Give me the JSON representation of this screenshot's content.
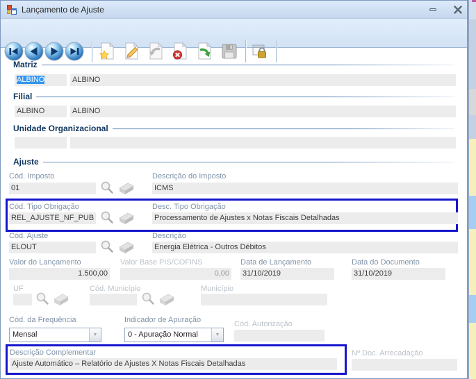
{
  "window": {
    "title": "Lançamento de Ajuste"
  },
  "toolbar": {
    "buttons": [
      "first-record",
      "previous-record",
      "next-record",
      "last-record",
      "new",
      "edit",
      "undo",
      "delete",
      "post",
      "save",
      "security-lock"
    ]
  },
  "groups": {
    "matriz": "Matriz",
    "filial": "Filial",
    "unidade": "Unidade Organizacional",
    "ajuste": "Ajuste"
  },
  "matriz": {
    "code": "ALBINO",
    "name": "ALBINO"
  },
  "filial": {
    "code": "ALBINO",
    "name": "ALBINO"
  },
  "unidade": {
    "code": "",
    "name": ""
  },
  "fields": {
    "cod_imposto": {
      "label": "Cód. Imposto",
      "value": "01"
    },
    "desc_imposto": {
      "label": "Descrição do Imposto",
      "value": "ICMS"
    },
    "cod_tipo_obrigacao": {
      "label": "Cód. Tipo Obrigação",
      "value": "REL_AJUSTE_NF_PUB"
    },
    "desc_tipo_obrigacao": {
      "label": "Desc. Tipo Obrigação",
      "value": "Processamento de Ajustes x Notas Fiscais Detalhadas"
    },
    "cod_ajuste": {
      "label": "Cód. Ajuste",
      "value": "ELOUT"
    },
    "descricao": {
      "label": "Descrição",
      "value": "Energia Elétrica - Outros Débitos"
    },
    "valor_lancamento": {
      "label": "Valor do Lançamento",
      "value": "1.500,00"
    },
    "valor_base": {
      "label": "Valor Base PIS/COFINS",
      "value": "0,00"
    },
    "data_lancamento": {
      "label": "Data de Lançamento",
      "value": "31/10/2019"
    },
    "data_documento": {
      "label": "Data do Documento",
      "value": "31/10/2019"
    },
    "uf": {
      "label": "UF",
      "value": ""
    },
    "cod_municipio": {
      "label": "Cód. Município",
      "value": ""
    },
    "municipio": {
      "label": "Município",
      "value": ""
    },
    "cod_frequencia": {
      "label": "Cód. da Frequência",
      "value": "Mensal"
    },
    "indicador_apuracao": {
      "label": "Indicador de Apuração",
      "value": "0 - Apuração Normal"
    },
    "cod_autorizacao": {
      "label": "Cód. Autorização",
      "value": ""
    },
    "descricao_complementar": {
      "label": "Descrição Complementar",
      "value": "Ajuste Automático – Relatório de Ajustes X Notas Fiscais Detalhadas"
    },
    "num_doc_arrecadacao": {
      "label": "Nº Doc. Arrecadação",
      "value": ""
    }
  },
  "icons": {
    "dropdown_arrow": "▼"
  },
  "colors": {
    "highlight_box": "#1515cd",
    "selection_bg": "#3296f0",
    "titlebar": "#cddcf0",
    "group_label": "#0f355f",
    "field_bg": "#ececec"
  }
}
